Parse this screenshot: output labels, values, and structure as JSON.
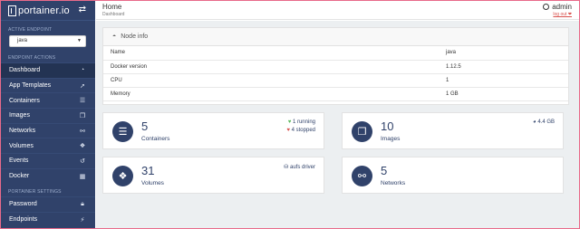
{
  "brand": {
    "name": "portainer.io",
    "swap_icon": "⇄"
  },
  "sidebar": {
    "active_endpoint_title": "ACTIVE ENDPOINT",
    "endpoint_value": "java",
    "endpoint_actions_title": "ENDPOINT ACTIONS",
    "items": [
      {
        "label": "Dashboard",
        "icon": "dashboard-icon",
        "glyph": "◔"
      },
      {
        "label": "App Templates",
        "icon": "rocket-icon",
        "glyph": "➚"
      },
      {
        "label": "Containers",
        "icon": "list-icon",
        "glyph": "☰"
      },
      {
        "label": "Images",
        "icon": "clone-icon",
        "glyph": "❐"
      },
      {
        "label": "Networks",
        "icon": "sitemap-icon",
        "glyph": "⚯"
      },
      {
        "label": "Volumes",
        "icon": "cubes-icon",
        "glyph": "❖"
      },
      {
        "label": "Events",
        "icon": "history-icon",
        "glyph": "↺"
      },
      {
        "label": "Docker",
        "icon": "th-icon",
        "glyph": "▦"
      }
    ],
    "settings_title": "PORTAINER SETTINGS",
    "settings_items": [
      {
        "label": "Password",
        "icon": "lock-icon",
        "glyph": "🔒︎"
      },
      {
        "label": "Endpoints",
        "icon": "plug-icon",
        "glyph": "⚡︎"
      }
    ]
  },
  "header": {
    "title": "Home",
    "breadcrumb": "Dashboard",
    "user": "admin",
    "logout": "log out ❤"
  },
  "node_info": {
    "title": "Node info",
    "rows": [
      {
        "key": "Name",
        "value": "java"
      },
      {
        "key": "Docker version",
        "value": "1.12.5"
      },
      {
        "key": "CPU",
        "value": "1"
      },
      {
        "key": "Memory",
        "value": "1 GB"
      }
    ]
  },
  "cards": {
    "containers": {
      "count": "5",
      "label": "Containers",
      "running": "1 running",
      "stopped": "4 stopped"
    },
    "images": {
      "count": "10",
      "label": "Images",
      "size": "4.4 GB"
    },
    "volumes": {
      "count": "31",
      "label": "Volumes",
      "driver": "aufs driver"
    },
    "networks": {
      "count": "5",
      "label": "Networks"
    }
  },
  "colors": {
    "sidebar": "#30426a",
    "accent": "#30426a",
    "running": "#5cb85c",
    "stopped": "#d9534f",
    "background": "#eceff1"
  }
}
